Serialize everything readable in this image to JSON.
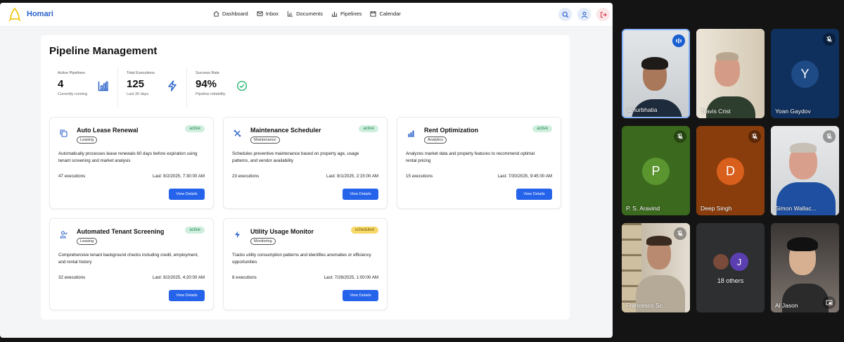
{
  "app": {
    "brand": "Homari"
  },
  "nav": [
    {
      "label": "Dashboard",
      "icon": "home-icon"
    },
    {
      "label": "Inbox",
      "icon": "mail-icon"
    },
    {
      "label": "Documents",
      "icon": "chart-icon"
    },
    {
      "label": "Pipelines",
      "icon": "bars-icon"
    },
    {
      "label": "Calendar",
      "icon": "calendar-icon"
    }
  ],
  "page": {
    "title": "Pipeline Management"
  },
  "stats": [
    {
      "label": "Active Pipelines",
      "value": "4",
      "sub": "Currently running",
      "icon": "bar-chart-icon"
    },
    {
      "label": "Total Executions",
      "value": "125",
      "sub": "Last 30 days",
      "icon": "lightning-icon"
    },
    {
      "label": "Success Rate",
      "value": "94%",
      "sub": "Pipeline reliability",
      "icon": "check-circle-icon"
    }
  ],
  "cards": [
    {
      "title": "Auto Lease Renewal",
      "tag": "Leasing",
      "status": "active",
      "desc": "Automatically processes lease renewals 60 days before expiration using tenant screening and market analysis",
      "executions": "47 executions",
      "last": "Last: 8/2/2025, 7:30:00 AM",
      "button": "View Details",
      "icon": "copy-icon"
    },
    {
      "title": "Maintenance Scheduler",
      "tag": "Maintenance",
      "status": "active",
      "desc": "Schedules preventive maintenance based on property age, usage patterns, and vendor availability",
      "executions": "23 executions",
      "last": "Last: 8/1/2025, 2:15:00 AM",
      "button": "View Details",
      "icon": "wrench-icon"
    },
    {
      "title": "Rent Optimization",
      "tag": "Analytics",
      "status": "active",
      "desc": "Analyzes market data and property features to recommend optimal rental pricing",
      "executions": "15 executions",
      "last": "Last: 7/30/2025, 9:45:00 AM",
      "button": "View Details",
      "icon": "bar-chart-icon"
    },
    {
      "title": "Automated Tenant Screening",
      "tag": "Leasing",
      "status": "active",
      "desc": "Comprehensive tenant background checks including credit, employment, and rental history",
      "executions": "32 executions",
      "last": "Last: 8/2/2025, 4:20:00 AM",
      "button": "View Details",
      "icon": "user-check-icon"
    },
    {
      "title": "Utility Usage Monitor",
      "tag": "Monitoring",
      "status": "scheduled",
      "desc": "Tracks utility consumption patterns and identifies anomalies or efficiency opportunities",
      "executions": "8 executions",
      "last": "Last: 7/28/2025, 1:00:00 AM",
      "button": "View Details",
      "icon": "lightning-icon"
    }
  ],
  "participants": [
    {
      "name": "amurbhatia",
      "speaking": true
    },
    {
      "name": "Travis Crist"
    },
    {
      "name": "Yoan Gaydov",
      "initial": "Y",
      "muted": true
    },
    {
      "name": "P. S. Aravind",
      "initial": "P",
      "muted": true
    },
    {
      "name": "Deep Singh",
      "initial": "D",
      "muted": true
    },
    {
      "name": "Simon Wallac...",
      "muted": true
    },
    {
      "name": "Francesco Sc...",
      "muted": true
    },
    {
      "name": "18 others",
      "initial": "J"
    },
    {
      "name": "Al Jason"
    }
  ],
  "colors": {
    "accent": "#2563eb",
    "brand": "#2a62c9",
    "active_bg": "#cfeede",
    "scheduled_bg": "#f7d96a"
  }
}
